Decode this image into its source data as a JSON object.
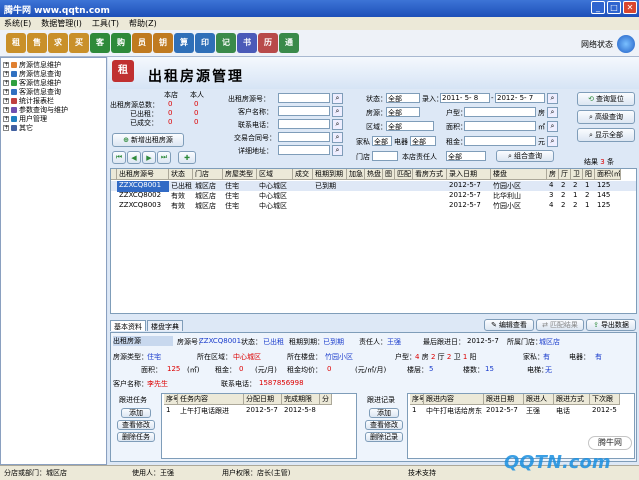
{
  "titlebar": {
    "title": "腾牛网 www.qqtn.com"
  },
  "menu": [
    "系统(E)",
    "数据管理(I)",
    "工具(T)",
    "帮助(Z)"
  ],
  "toolbar": {
    "buttons": [
      {
        "name": "rent-tool",
        "glyph": "租",
        "color": "#c9902a"
      },
      {
        "name": "sell-tool",
        "glyph": "售",
        "color": "#c9902a"
      },
      {
        "name": "want-rent-tool",
        "glyph": "求",
        "color": "#c9902a"
      },
      {
        "name": "want-buy-tool",
        "glyph": "买",
        "color": "#c9902a"
      },
      {
        "name": "client-rent-tool",
        "glyph": "客",
        "color": "#2e8a3a"
      },
      {
        "name": "client-buy-tool",
        "glyph": "购",
        "color": "#2e8a3a"
      },
      {
        "name": "agent-tool",
        "glyph": "员",
        "color": "#c07a20"
      },
      {
        "name": "key-tool",
        "glyph": "钥",
        "color": "#c07a20"
      },
      {
        "name": "calculator-tool",
        "glyph": "算",
        "color": "#2f6fb8"
      },
      {
        "name": "print-tool",
        "glyph": "印",
        "color": "#2f6fb8"
      },
      {
        "name": "notepad-tool",
        "glyph": "记",
        "color": "#3a8a4a"
      },
      {
        "name": "book-tool",
        "glyph": "书",
        "color": "#4a5ab8"
      },
      {
        "name": "calendar-tool",
        "glyph": "历",
        "color": "#b84a4a"
      },
      {
        "name": "contacts-tool",
        "glyph": "通",
        "color": "#3a8a4a"
      }
    ],
    "net_status": "网络状态"
  },
  "tree": [
    "房源信息维护",
    "房源信息查询",
    "客源信息维护",
    "客源信息查询",
    "统计报表栏",
    "参数查询与维护",
    "用户管理",
    "其它"
  ],
  "page_title": "出租房源管理",
  "stats": {
    "col_store": "本店",
    "col_self": "本人",
    "row1": "出租房源总数：",
    "row2": "已出租：",
    "row3": "已成交：",
    "v11": "0",
    "v12": "0",
    "v21": "0",
    "v22": "0",
    "v31": "0",
    "v32": "0"
  },
  "add_button": "新增出租房源",
  "form": {
    "house_no": "出租房源号：",
    "client": "客户名称：",
    "phone": "联系电话：",
    "deal_no": "交易合同号：",
    "address": "详细地址：",
    "status": "状态：",
    "status_val": "全部",
    "entry": "录入：",
    "date_from": "2011- 5- 8",
    "date_to": "2012- 5- 7",
    "room_type": "房源：",
    "room_val": "全部",
    "area": "区域：",
    "area_val": "全部",
    "layout": "户型：",
    "size": "面积：",
    "furniture": "家私",
    "appliance": "电器",
    "furn_val": "全部",
    "app_val": "全部",
    "rent": "租金：",
    "store": "门店",
    "store_val": "",
    "agent": "本店责任人",
    "agent_val": "全部",
    "unit_room": "房",
    "unit_sqm": "㎡",
    "unit_yuan": "元"
  },
  "buttons": {
    "reset": "查询复位",
    "advanced": "高级查询",
    "show_all": "显示全部",
    "combo": "组合查询"
  },
  "result": {
    "label": "结果",
    "count": "3",
    "unit": "条"
  },
  "grid": {
    "headers": [
      "出租房源号",
      "状态",
      "门店",
      "房屋类型",
      "区域",
      "成交",
      "租期到期",
      "加急",
      "热盘",
      "图",
      "匹配",
      "看房方式",
      "录入日期",
      "楼盘",
      "房",
      "厅",
      "卫",
      "阳",
      "面积(㎡)"
    ],
    "rows": [
      [
        "ZZXCQ8001",
        "已出租",
        "城区店",
        "住宅",
        "中心城区",
        "",
        "已到期",
        "",
        "",
        "",
        "",
        "",
        "2012-5-7",
        "竹园小区",
        "4",
        "2",
        "2",
        "1",
        "125"
      ],
      [
        "ZZXCQ8002",
        "有效",
        "城区店",
        "住宅",
        "中心城区",
        "",
        "",
        "",
        "",
        "",
        "",
        "",
        "2012-5-7",
        "比华利山",
        "3",
        "2",
        "1",
        "2",
        "145"
      ],
      [
        "ZZXCQ8003",
        "有效",
        "城区店",
        "住宅",
        "中心城区",
        "",
        "",
        "",
        "",
        "",
        "",
        "",
        "2012-5-7",
        "竹园小区",
        "4",
        "2",
        "2",
        "1",
        "125"
      ]
    ]
  },
  "detail_tabs": [
    "基本资料",
    "楼盘字典"
  ],
  "detail_buttons": {
    "edit": "编辑查看",
    "match": "匹配结果",
    "export": "导出数据"
  },
  "detail": {
    "house_label": "出租房源",
    "house_no_label": "房源号：",
    "house_no": "ZZXCQ8001",
    "status_label": "状态：",
    "status": "已出租",
    "lease_label": "租期到期：",
    "lease": "已到期",
    "agent_label": "责任人：",
    "agent": "王强",
    "last_follow_label": "最后跟进日：",
    "last_follow": "2012-5-7",
    "store_label": "所属门店：",
    "store": "城区店",
    "type_label": "房源类型：",
    "type": "住宅",
    "area_label": "所在区域：",
    "area": "中心城区",
    "estate_label": "所在楼盘：",
    "estate": "竹园小区",
    "layout_label": "户型：",
    "l1": "4",
    "l1u": "房",
    "l2": "2",
    "l2u": "厅",
    "l3": "2",
    "l3u": "卫",
    "l4": "1",
    "l4u": "阳",
    "furn_label": "家私：",
    "furn": "有",
    "app_label": "电器：",
    "app": "有",
    "size_label": "面积：",
    "size": "125",
    "size_unit": "(㎡)",
    "rent_label": "租金：",
    "rent": "0",
    "rent_unit": "(元/月)",
    "avg_label": "租金均价：",
    "avg": "0",
    "avg_unit": "(元/㎡/月)",
    "floor_label": "楼层：",
    "floor": "5",
    "total_floor_label": "楼数：",
    "total_floor": "15",
    "elev_label": "电梯：",
    "elev": "无",
    "client_label": "客户名称：",
    "client": "李先生",
    "phone_label": "联系电话：",
    "phone": "1587856998"
  },
  "tasks": {
    "title": "跟进任务",
    "add": "添加",
    "view": "查看修改",
    "del": "删除任务",
    "headers": [
      "序号",
      "任务内容",
      "分配日期",
      "完成期限",
      "分"
    ],
    "row": [
      "1",
      "上午打电话跟进",
      "2012-5-7",
      "2012-5-8",
      ""
    ]
  },
  "records": {
    "title": "跟进记录",
    "add": "添加",
    "view": "查看修改",
    "del": "删除记录",
    "headers": [
      "序号",
      "跟进内容",
      "跟进日期",
      "跟进人",
      "跟进方式",
      "下次跟"
    ],
    "row": [
      "1",
      "中午打电话给房东",
      "2012-5-7",
      "王强",
      "电话",
      "2012-5"
    ]
  },
  "status": {
    "dept": "分店或部门：城区店",
    "user": "使用人：王强",
    "role": "用户权限：店长(主管)",
    "support": "技术支持"
  },
  "watermark": {
    "brand": "腾牛网",
    "site": "QQTN.com"
  }
}
